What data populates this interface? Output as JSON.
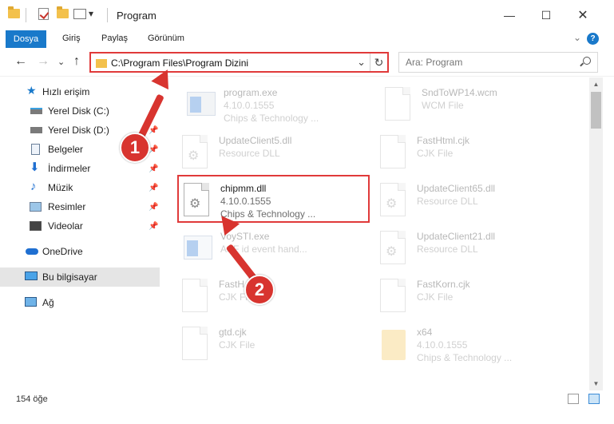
{
  "titlebar": {
    "title": "Program",
    "qat_dropdown": "▾"
  },
  "window_controls": {
    "minimize": "—",
    "maximize": "☐",
    "close": "✕"
  },
  "ribbon": {
    "tabs": [
      {
        "label": "Dosya"
      },
      {
        "label": "Giriş"
      },
      {
        "label": "Paylaş"
      },
      {
        "label": "Görünüm"
      }
    ],
    "help": "?",
    "collapse": "⌄"
  },
  "nav": {
    "back": "←",
    "forward": "→",
    "recent": "⌄",
    "up": "↑"
  },
  "address": {
    "path": "C:\\Program Files\\Program Dizini",
    "dropdown": "⌄",
    "refresh": "↻"
  },
  "search": {
    "placeholder": "Ara: Program"
  },
  "sidebar": {
    "quick_access": "Hızlı erişim",
    "items": [
      {
        "label": "Yerel Disk (C:)",
        "icon": "drive-icon",
        "pinned": true
      },
      {
        "label": "Yerel Disk (D:)",
        "icon": "drive-icon",
        "pinned": true
      },
      {
        "label": "Belgeler",
        "icon": "documents-icon",
        "pinned": true
      },
      {
        "label": "İndirmeler",
        "icon": "download-icon",
        "pinned": true
      },
      {
        "label": "Müzik",
        "icon": "music-icon",
        "pinned": true
      },
      {
        "label": "Resimler",
        "icon": "pictures-icon",
        "pinned": true
      },
      {
        "label": "Videolar",
        "icon": "videos-icon",
        "pinned": true
      }
    ],
    "onedrive": "OneDrive",
    "this_pc": "Bu bilgisayar",
    "network": "Ağ"
  },
  "files": [
    {
      "name": "program.exe",
      "line1": "4.10.0.1555",
      "line2": "Chips & Technology ...",
      "type": "exe"
    },
    {
      "name": "SndToWP14.wcm",
      "line1": "WCM File",
      "line2": "",
      "type": "doc"
    },
    {
      "name": "UpdateClient5.dll",
      "line1": "Resource DLL",
      "line2": "",
      "type": "dll"
    },
    {
      "name": "FastHtml.cjk",
      "line1": "CJK File",
      "line2": "",
      "type": "doc"
    },
    {
      "name": "chipmm.dll",
      "line1": "4.10.0.1555",
      "line2": "Chips & Technology ...",
      "type": "dll"
    },
    {
      "name": "UpdateClient65.dll",
      "line1": "Resource DLL",
      "line2": "",
      "type": "dll"
    },
    {
      "name": "VoySTI.exe",
      "line1": "ASF id event hand...",
      "line2": "",
      "type": "exe"
    },
    {
      "name": "UpdateClient21.dll",
      "line1": "Resource DLL",
      "line2": "",
      "type": "dll"
    },
    {
      "name": "FastH",
      "line1": "CJK File",
      "line2": "",
      "type": "doc"
    },
    {
      "name": "FastKorn.cjk",
      "line1": "CJK File",
      "line2": "",
      "type": "doc"
    },
    {
      "name": "gtd.cjk",
      "line1": "CJK File",
      "line2": "",
      "type": "doc"
    },
    {
      "name": "x64",
      "line1": "4.10.0.1555",
      "line2": "Chips & Technology ...",
      "type": "folder"
    }
  ],
  "scrollbar": {
    "up": "▲",
    "down": "▼"
  },
  "status": {
    "count": "154 öğe"
  },
  "callouts": {
    "one": "1",
    "two": "2"
  },
  "colors": {
    "accent": "#1979ca",
    "highlight": "#e03a3a",
    "callout": "#d8342f"
  }
}
